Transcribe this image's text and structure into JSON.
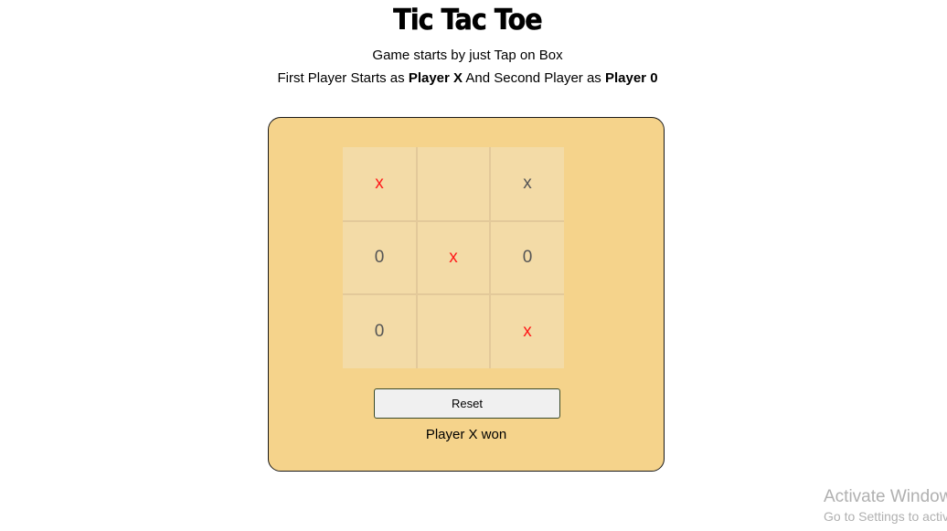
{
  "header": {
    "title": "Tic Tac Toe",
    "subtitle": "Game starts by just Tap on Box",
    "instructions": {
      "part1": "First Player Starts as ",
      "player1": "Player X",
      "part2": " And Second Player as ",
      "player2": "Player 0"
    }
  },
  "board": {
    "cells": [
      {
        "value": "x",
        "color": "#ff1a1a"
      },
      {
        "value": "",
        "color": ""
      },
      {
        "value": "x",
        "color": "#555555"
      },
      {
        "value": "0",
        "color": "#555555"
      },
      {
        "value": "x",
        "color": "#ff1a1a"
      },
      {
        "value": "0",
        "color": "#555555"
      },
      {
        "value": "0",
        "color": "#555555"
      },
      {
        "value": "",
        "color": ""
      },
      {
        "value": "x",
        "color": "#ff1a1a"
      }
    ]
  },
  "controls": {
    "reset_label": "Reset"
  },
  "status": {
    "message": "Player X won"
  },
  "watermark": {
    "line1": "Activate Windows",
    "line2": "Go to Settings to activate Windows."
  },
  "colors": {
    "card_background": "#f5d38b",
    "cell_background": "#f3dba7",
    "winning_mark": "#ff1a1a",
    "regular_mark": "#555555"
  }
}
